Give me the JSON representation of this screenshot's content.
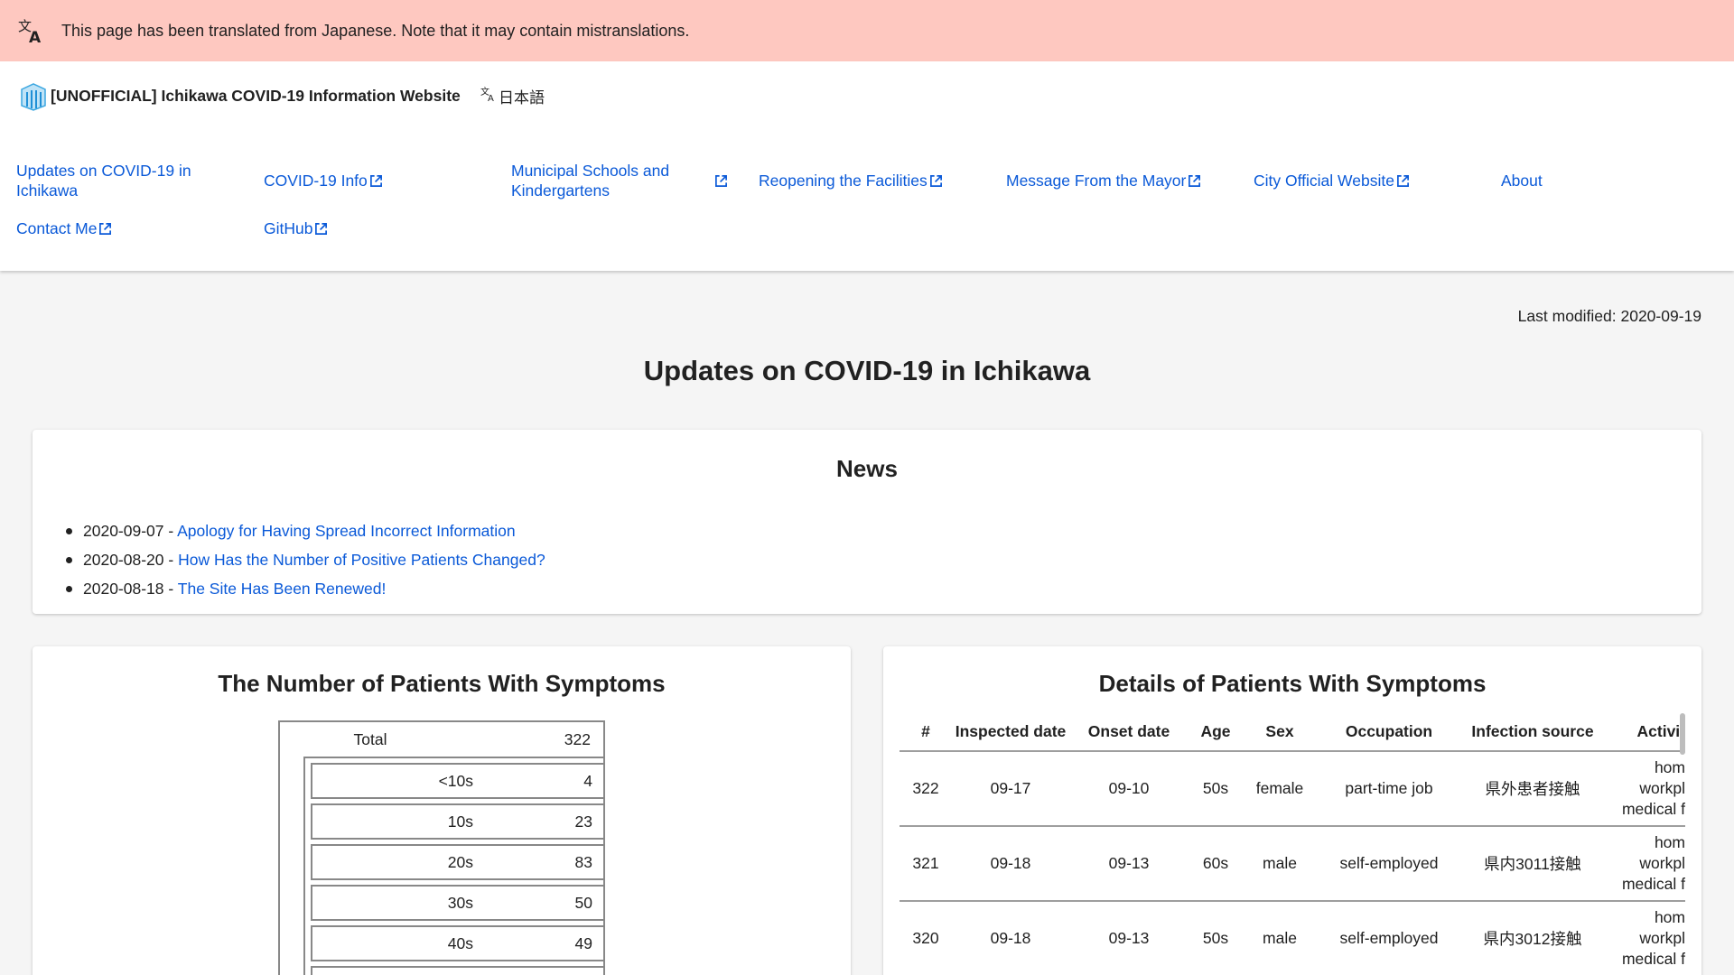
{
  "banner": {
    "text": "This page has been translated from Japanese. Note that it may contain mistranslations.",
    "icon": "translate-icon",
    "bg_color": "#fec8c0"
  },
  "header": {
    "site_title": "[UNOFFICIAL] Ichikawa COVID-19 Information Website",
    "language": "日本語"
  },
  "nav": {
    "items": [
      {
        "label": "Updates on COVID-19 in Ichikawa",
        "external": false
      },
      {
        "label": "COVID-19 Info",
        "external": true
      },
      {
        "label": "Municipal Schools and Kindergartens",
        "external": true
      },
      {
        "label": "Reopening the Facilities",
        "external": true
      },
      {
        "label": "Message From the Mayor",
        "external": true
      },
      {
        "label": "City Official Website",
        "external": true
      },
      {
        "label": "About",
        "external": false
      },
      {
        "label": "Contact Me",
        "external": true
      },
      {
        "label": "GitHub",
        "external": true
      }
    ]
  },
  "page": {
    "last_modified": "Last modified: 2020-09-19",
    "title": "Updates on COVID-19 in Ichikawa"
  },
  "news": {
    "heading": "News",
    "items": [
      {
        "date": "2020-09-07 - ",
        "title": "Apology for Having Spread Incorrect Information"
      },
      {
        "date": "2020-08-20 - ",
        "title": "How Has the Number of Positive Patients Changed?"
      },
      {
        "date": "2020-08-18 - ",
        "title": "The Site Has Been Renewed!"
      }
    ]
  },
  "symptoms": {
    "heading": "The Number of Patients With Symptoms",
    "total_label": "Total",
    "total_value": "322",
    "ages": [
      {
        "label": "<10s",
        "value": "4"
      },
      {
        "label": "10s",
        "value": "23"
      },
      {
        "label": "20s",
        "value": "83"
      },
      {
        "label": "30s",
        "value": "50"
      },
      {
        "label": "40s",
        "value": "49"
      }
    ]
  },
  "details": {
    "heading": "Details of Patients With Symptoms",
    "columns": [
      "#",
      "Inspected date",
      "Onset date",
      "Age",
      "Sex",
      "Occupation",
      "Infection source",
      "Activit"
    ],
    "rows": [
      {
        "no": "322",
        "inspected": "09-17",
        "onset": "09-10",
        "age": "50s",
        "sex": "female",
        "occupation": "part-time job",
        "source": "県外患者接触",
        "act1": "hom",
        "act2": "workpl",
        "act3": "medical f"
      },
      {
        "no": "321",
        "inspected": "09-18",
        "onset": "09-13",
        "age": "60s",
        "sex": "male",
        "occupation": "self-employed",
        "source": "県内3011接触",
        "act1": "hom",
        "act2": "workpl",
        "act3": "medical f"
      },
      {
        "no": "320",
        "inspected": "09-18",
        "onset": "09-13",
        "age": "50s",
        "sex": "male",
        "occupation": "self-employed",
        "source": "県内3012接触",
        "act1": "hom",
        "act2": "workpl",
        "act3": "medical f"
      }
    ]
  },
  "colors": {
    "link": "#0a59d8",
    "text": "#212121",
    "page_bg": "#f5f5f5"
  }
}
